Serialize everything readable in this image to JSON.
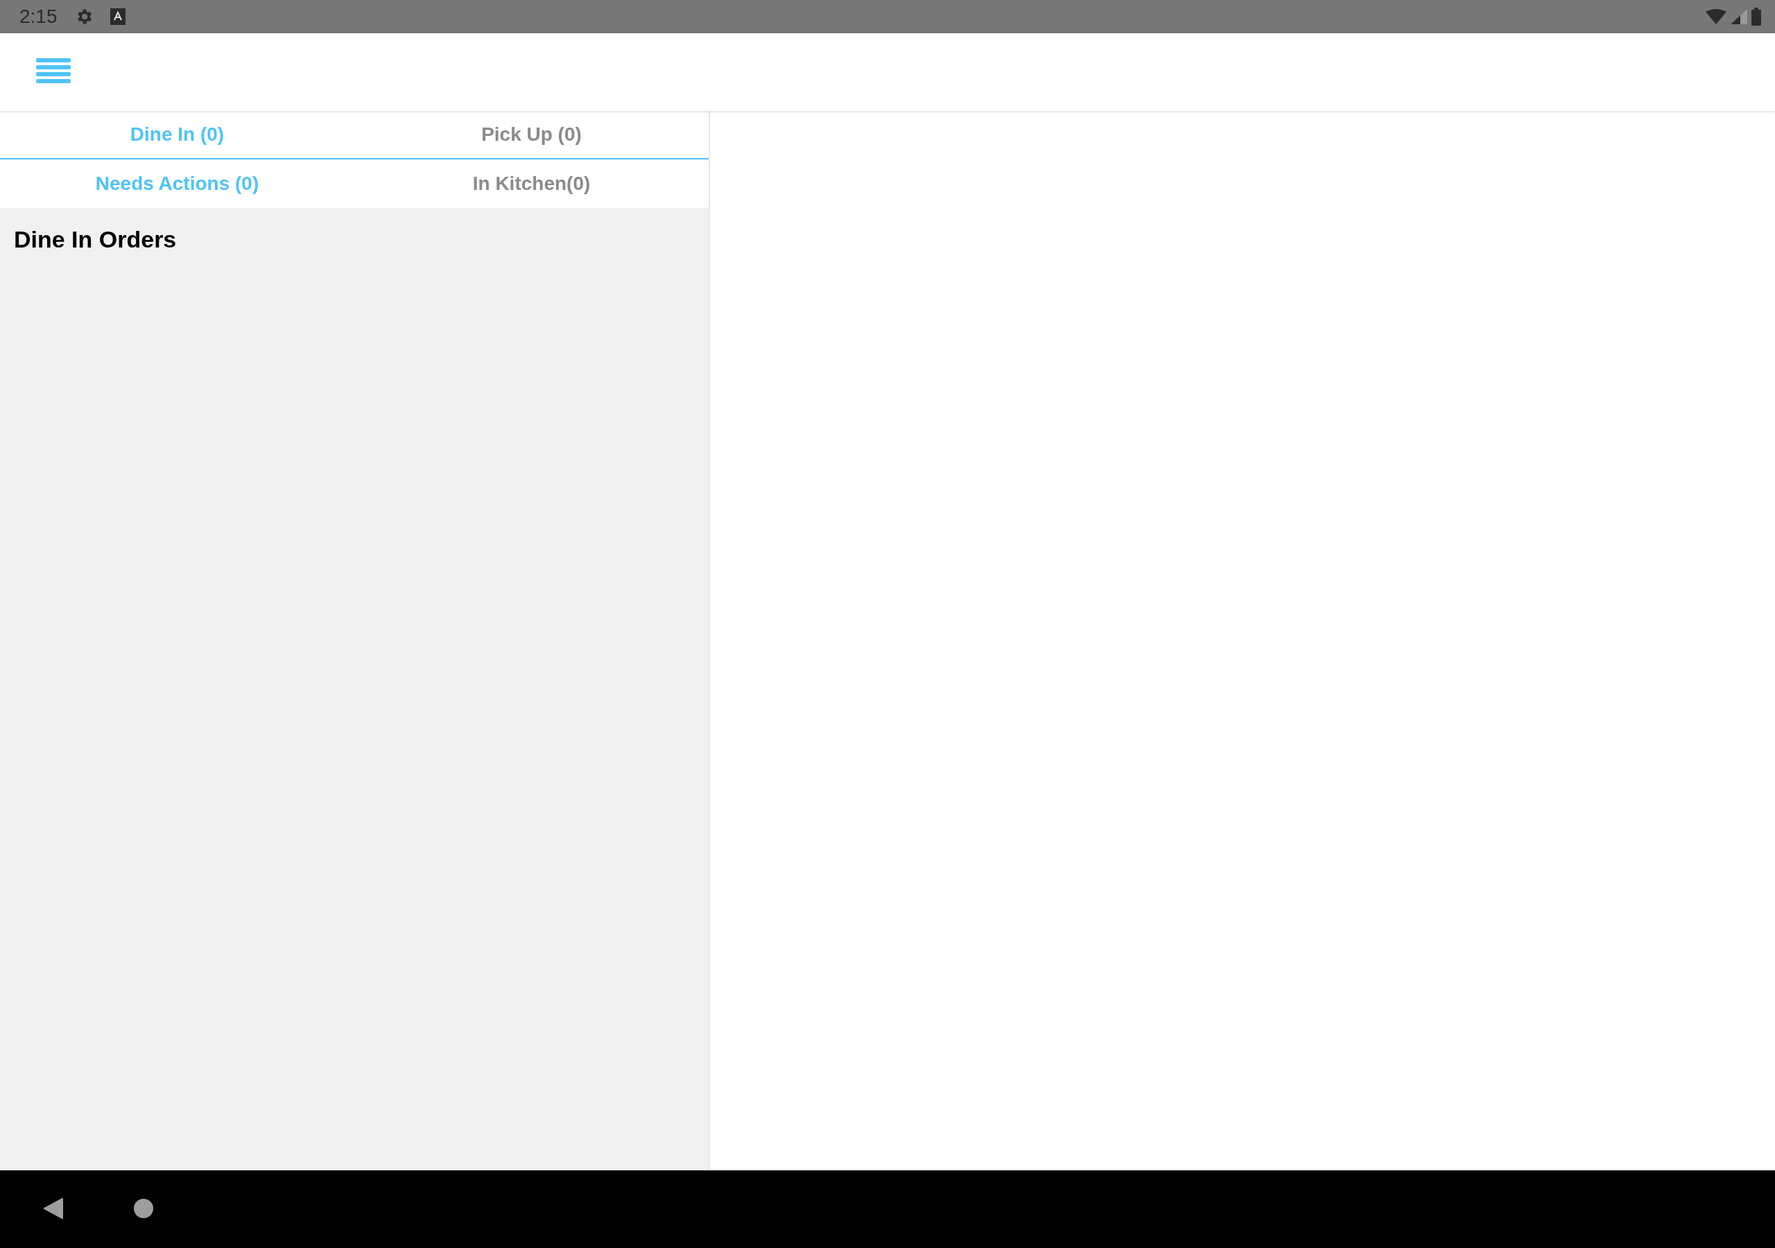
{
  "status_bar": {
    "time": "2:15"
  },
  "order_type_tabs": [
    {
      "label": "Dine In (0)",
      "selected": true
    },
    {
      "label": "Pick Up (0)",
      "selected": false
    }
  ],
  "status_tabs": [
    {
      "label": "Needs Actions (0)",
      "selected": true
    },
    {
      "label": "In Kitchen(0)",
      "selected": false
    }
  ],
  "list": {
    "title": "Dine In Orders"
  }
}
